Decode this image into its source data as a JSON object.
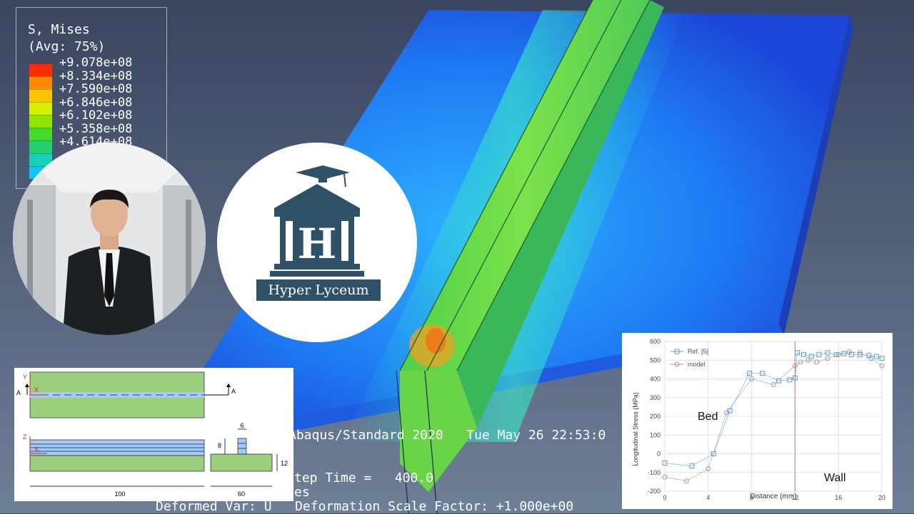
{
  "legend": {
    "title": "S, Mises",
    "subtitle": "(Avg: 75%)",
    "values": [
      "+9.078e+08",
      "+8.334e+08",
      "+7.590e+08",
      "+6.846e+08",
      "+6.102e+08",
      "+5.358e+08",
      "+4.614e+08"
    ],
    "colors": [
      "#ff2a00",
      "#ff8a00",
      "#ffc400",
      "#d8ee00",
      "#8fe600",
      "#44dc2a",
      "#22d06e",
      "#18d0b8",
      "#14c4f0"
    ]
  },
  "viewport": {
    "software_line": "Abaqus/Standard 2020   Tue May 26 22:53:0",
    "step_line": "tep Time =   400.0",
    "var_line": "es",
    "deformed_line": "Deformed Var: U   Deformation Scale Factor: +1.000e+00"
  },
  "logo": {
    "letter": "H",
    "name": "Hyper Lyceum"
  },
  "schematic": {
    "axis_y": "Y",
    "axis_x": "X",
    "axis_z": "Z",
    "section_a_left": "A",
    "section_a_right": "A",
    "dim_length": "100",
    "dim_width": "60",
    "dim_height": "12",
    "dim_bead_width": "6",
    "dim_bead_height": "8",
    "colors": {
      "plate": "#9bcf7e",
      "bead": "#a9c9ee",
      "line": "#1e4f9e"
    }
  },
  "chart_data": {
    "type": "scatter",
    "xlabel": "Distance (mm)",
    "ylabel": "Longitudinal Stress (MPa)",
    "xlim": [
      0,
      20
    ],
    "ylim": [
      -200,
      600
    ],
    "x_ticks": [
      "0",
      "4",
      "8",
      "12",
      "16",
      "20"
    ],
    "y_ticks": [
      "600",
      "500",
      "400",
      "300",
      "200",
      "100",
      "0",
      "-100",
      "-200"
    ],
    "annotations": [
      "Bed",
      "Wall"
    ],
    "divider_x": 12,
    "series": [
      {
        "name": "Ref. [5]",
        "marker": "square",
        "color": "#5b9bd5",
        "x": [
          0,
          2.5,
          4.5,
          6,
          7.8,
          9,
          10.5,
          11.5,
          12,
          12.2,
          12.8,
          13.5,
          14.2,
          15,
          15.8,
          16.5,
          17.2,
          18,
          18.8,
          19.5,
          20
        ],
        "y": [
          -50,
          -65,
          0,
          230,
          430,
          430,
          390,
          395,
          405,
          540,
          530,
          520,
          530,
          540,
          530,
          535,
          530,
          530,
          525,
          520,
          510
        ]
      },
      {
        "name": "model",
        "marker": "circle",
        "color": "#9a9a9a",
        "x": [
          0,
          2,
          4,
          5.7,
          8,
          10,
          12,
          12.5,
          13.2,
          14,
          15,
          16,
          17,
          18,
          19,
          20
        ],
        "y": [
          -125,
          -145,
          -80,
          220,
          400,
          370,
          470,
          490,
          500,
          490,
          510,
          530,
          545,
          540,
          510,
          470
        ]
      }
    ]
  }
}
